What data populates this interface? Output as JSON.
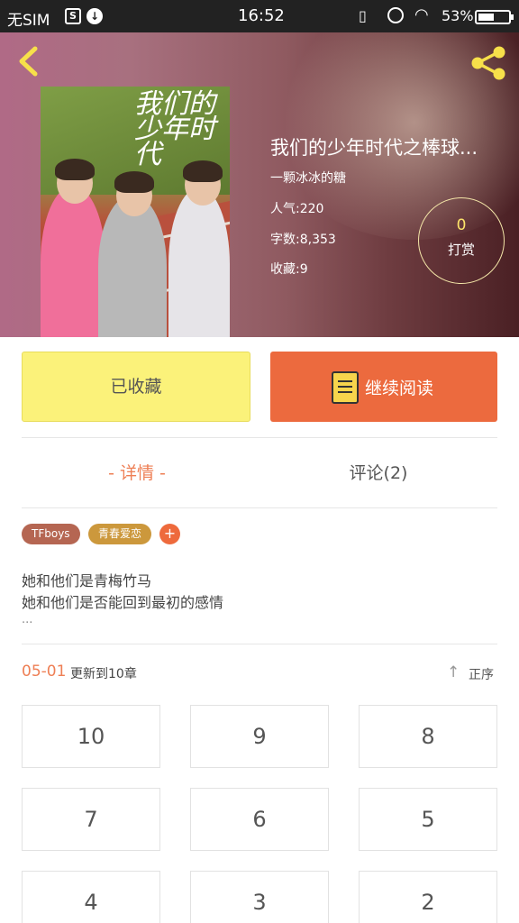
{
  "status_bar": {
    "carrier": "无SIM",
    "time": "16:52",
    "battery_percent": "53%",
    "battery_level": 0.53,
    "icons": [
      "s-icon",
      "download-icon",
      "vibrate-icon",
      "alarm-icon",
      "wifi-icon",
      "battery-icon"
    ]
  },
  "header": {
    "back_icon": "chevron-left-icon",
    "share_icon": "share-icon",
    "cover_title": "我们的少年时代",
    "book_title": "我们的少年时代之棒球...",
    "author": "一颗冰冰的糖",
    "popularity": "人气:220",
    "word_count": "字数:8,353",
    "favorites": "收藏:9",
    "tip_count": "0",
    "tip_label": "打赏",
    "accent_colors": {
      "tip_count": "#fde46a",
      "tip_border": "#f4e6a8"
    }
  },
  "actions": {
    "favorite_label": "已收藏",
    "read_label": "继续阅读",
    "read_icon": "book-icon",
    "colors": {
      "favorite_bg": "#fbf27a",
      "read_bg": "#ec6a3e"
    }
  },
  "tabs": {
    "detail": "- 详情 -",
    "comments": "评论(2)",
    "active": "detail"
  },
  "tags": [
    "TFboys",
    "青春爱恋"
  ],
  "tag_add": "+",
  "description": {
    "line1": "她和他们是青梅竹马",
    "line2": "她和他们是否能回到最初的感情",
    "more": "..."
  },
  "update": {
    "date": "05-01",
    "text": "更新到10章",
    "sort_label": "正序",
    "sort_icon": "arrow-up-icon"
  },
  "chapters": [
    "10",
    "9",
    "8",
    "7",
    "6",
    "5",
    "4",
    "3",
    "2"
  ]
}
